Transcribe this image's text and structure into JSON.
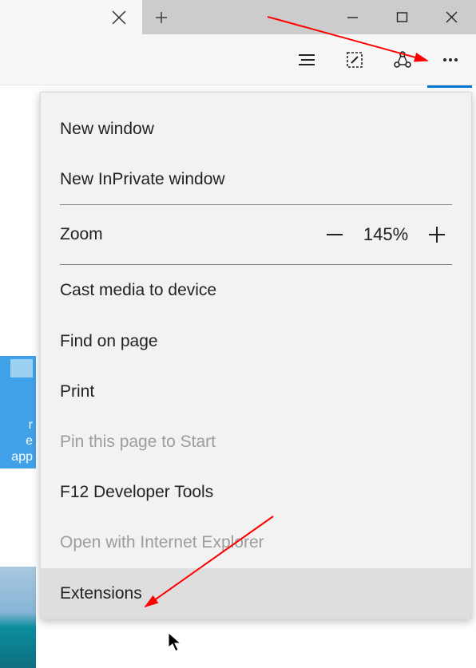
{
  "window": {
    "minimize_tooltip": "Minimize",
    "maximize_tooltip": "Maximize",
    "close_tooltip": "Close"
  },
  "tabs": {
    "close_current": "Close tab",
    "new_tab": "New tab"
  },
  "toolbar": {
    "readinglist_icon": "reading-view",
    "notes_icon": "web-note",
    "share_icon": "share",
    "more_icon": "more"
  },
  "left": {
    "tile1_line1": "r",
    "tile1_line2": "e app"
  },
  "menu": {
    "new_window": "New window",
    "new_inprivate": "New InPrivate window",
    "zoom_label": "Zoom",
    "zoom_value": "145%",
    "cast": "Cast media to device",
    "find": "Find on page",
    "print": "Print",
    "pin": "Pin this page to Start",
    "devtools": "F12 Developer Tools",
    "open_ie": "Open with Internet Explorer",
    "extensions": "Extensions"
  }
}
